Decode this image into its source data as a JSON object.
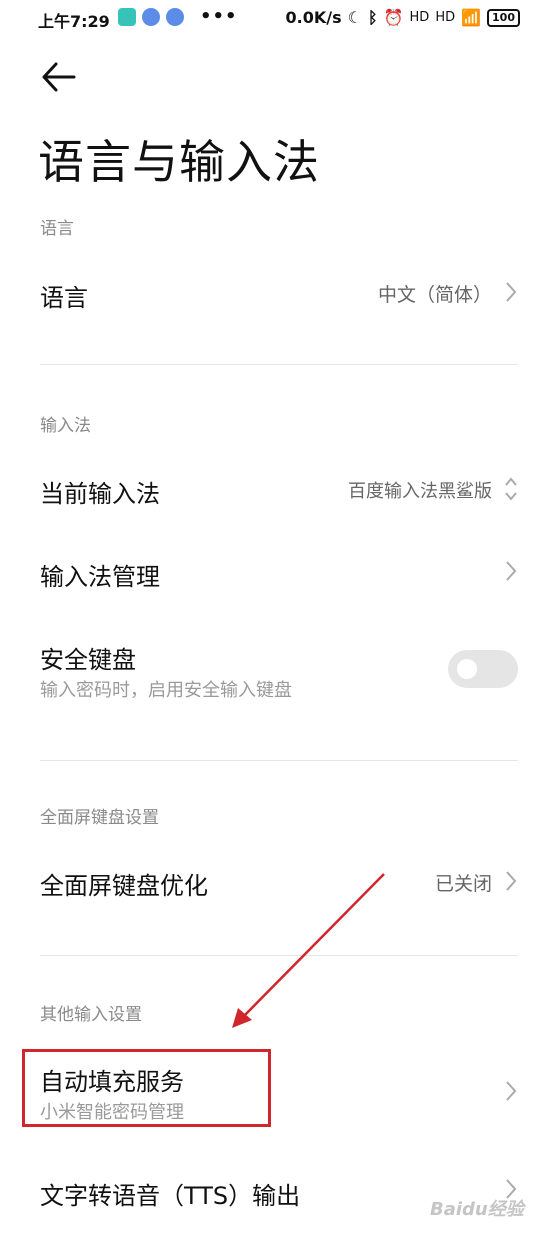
{
  "status_bar": {
    "time": "上午7:29",
    "dots": "•••",
    "speed": "0.0K/s",
    "signal_1": "HD",
    "signal_2": "HD",
    "battery": "100"
  },
  "header": {
    "title": "语言与输入法"
  },
  "sections": {
    "language": {
      "label": "语言",
      "item": {
        "title": "语言",
        "value": "中文（简体）"
      }
    },
    "input_method": {
      "label": "输入法",
      "current": {
        "title": "当前输入法",
        "value": "百度输入法黑鲨版"
      },
      "manage": {
        "title": "输入法管理"
      },
      "secure_keyboard": {
        "title": "安全键盘",
        "subtitle": "输入密码时，启用安全输入键盘",
        "enabled": false
      }
    },
    "fullscreen": {
      "label": "全面屏键盘设置",
      "optimize": {
        "title": "全面屏键盘优化",
        "value": "已关闭"
      }
    },
    "other": {
      "label": "其他输入设置",
      "autofill": {
        "title": "自动填充服务",
        "subtitle": "小米智能密码管理"
      },
      "tts": {
        "title": "文字转语音（TTS）输出"
      }
    }
  },
  "annotation": {
    "color": "#d0262c"
  },
  "watermark": "Baidu经验"
}
